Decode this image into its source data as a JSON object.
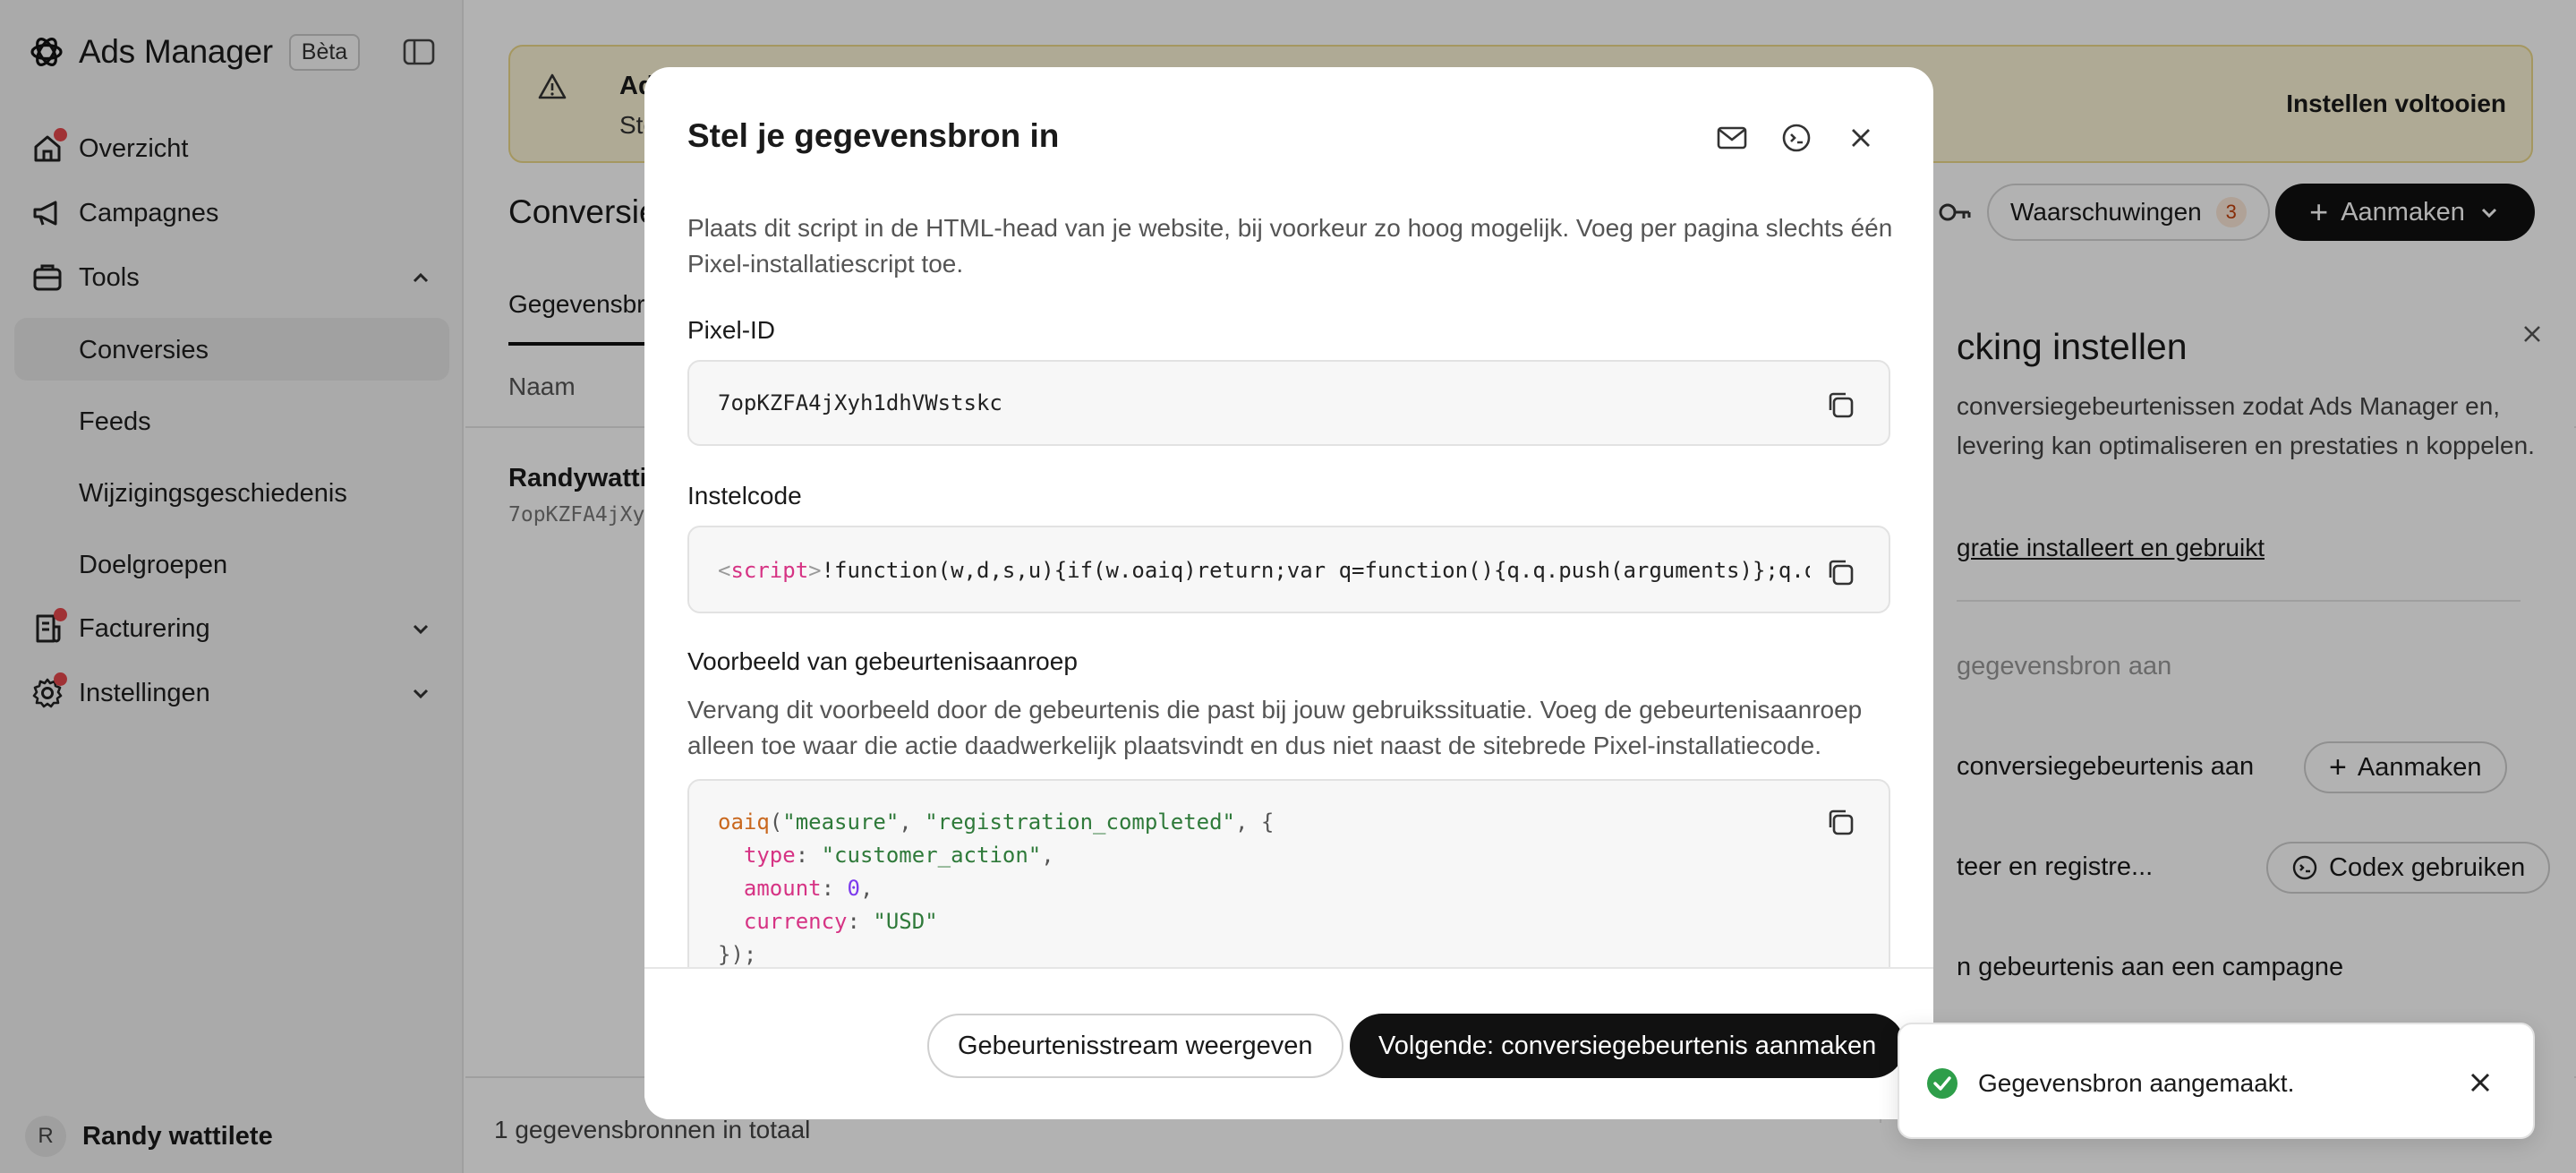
{
  "app": {
    "title": "Ads Manager",
    "badge": "Bèta"
  },
  "sidebar": {
    "items": [
      {
        "label": "Overzicht",
        "icon": "home-icon",
        "has_dot": true
      },
      {
        "label": "Campagnes",
        "icon": "megaphone-icon",
        "has_dot": false
      },
      {
        "label": "Tools",
        "icon": "toolbox-icon",
        "expanded": true
      }
    ],
    "tools_sub": [
      "Conversies",
      "Feeds",
      "Wijzigingsgeschiedenis",
      "Doelgroepen"
    ],
    "active_sub": "Conversies",
    "bottom_items": [
      {
        "label": "Facturering",
        "icon": "billing-icon",
        "has_dot": true
      },
      {
        "label": "Instellingen",
        "icon": "gear-icon",
        "has_dot": true
      }
    ],
    "user": {
      "initial": "R",
      "name": "Randy wattilete"
    }
  },
  "banner": {
    "title": "Adver",
    "text": "Stel fa",
    "cta": "Instellen voltooien"
  },
  "page": {
    "title": "Conversie",
    "warnings_label": "Waarschuwingen",
    "warnings_count": "3",
    "create_label": "Aanmaken",
    "tab_active": "Gegevensbr",
    "col_name": "Naam",
    "row_name": "Randywattil",
    "row_id": "7opKZFA4jXy",
    "total": "1 gegevensbronnen in totaal"
  },
  "side_panel": {
    "title": "cking instellen",
    "text": "conversiegebeurtenissen zodat Ads Manager en, levering kan optimaliseren en prestaties n koppelen.",
    "link": "gratie installeert en gebruikt",
    "step1": "gegevensbron aan",
    "step2": "conversiegebeurtenis aan",
    "step2_btn": "Aanmaken",
    "step3": "teer en registre...",
    "step3_btn": "Codex gebruiken",
    "step4": "n gebeurtenis aan een campagne"
  },
  "modal": {
    "title": "Stel je gegevensbron in",
    "description": "Plaats dit script in de HTML-head van je website, bij voorkeur zo hoog mogelijk. Voeg per pagina slechts één Pixel-installatiescript toe.",
    "pixel_label": "Pixel-ID",
    "pixel_id": "7opKZFA4jXyh1dhVWstskc",
    "install_label": "Instelcode",
    "install_code": {
      "open_tag": "<",
      "tag": "script",
      "close": ">",
      "body": "!function(w,d,s,u){if(w.oaiq)return;var q=function(){q.q.push(arguments)};q.q"
    },
    "example_label": "Voorbeeld van gebeurtenisaanroep",
    "example_desc": "Vervang dit voorbeeld door de gebeurtenis die past bij jouw gebruikssituatie. Voeg de gebeurtenisaanroep alleen toe waar die actie daadwerkelijk plaatsvindt en dus niet naast de sitebrede Pixel-installatiecode.",
    "example_code": {
      "fn": "oaiq",
      "arg1": "\"measure\"",
      "arg2": "\"registration_completed\"",
      "k_type": "type",
      "v_type": "\"customer_action\"",
      "k_amount": "amount",
      "v_amount": "0",
      "k_currency": "currency",
      "v_currency": "\"USD\"",
      "end": "});"
    },
    "btn_secondary": "Gebeurtenisstream weergeven",
    "btn_primary": "Volgende: conversiegebeurtenis aanmaken"
  },
  "toast": {
    "message": "Gegevensbron aangemaakt."
  },
  "colors": {
    "accent": "#111111",
    "success": "#2e9e4a",
    "dot": "#e5484d",
    "banner_bg": "#fbf4d6"
  }
}
